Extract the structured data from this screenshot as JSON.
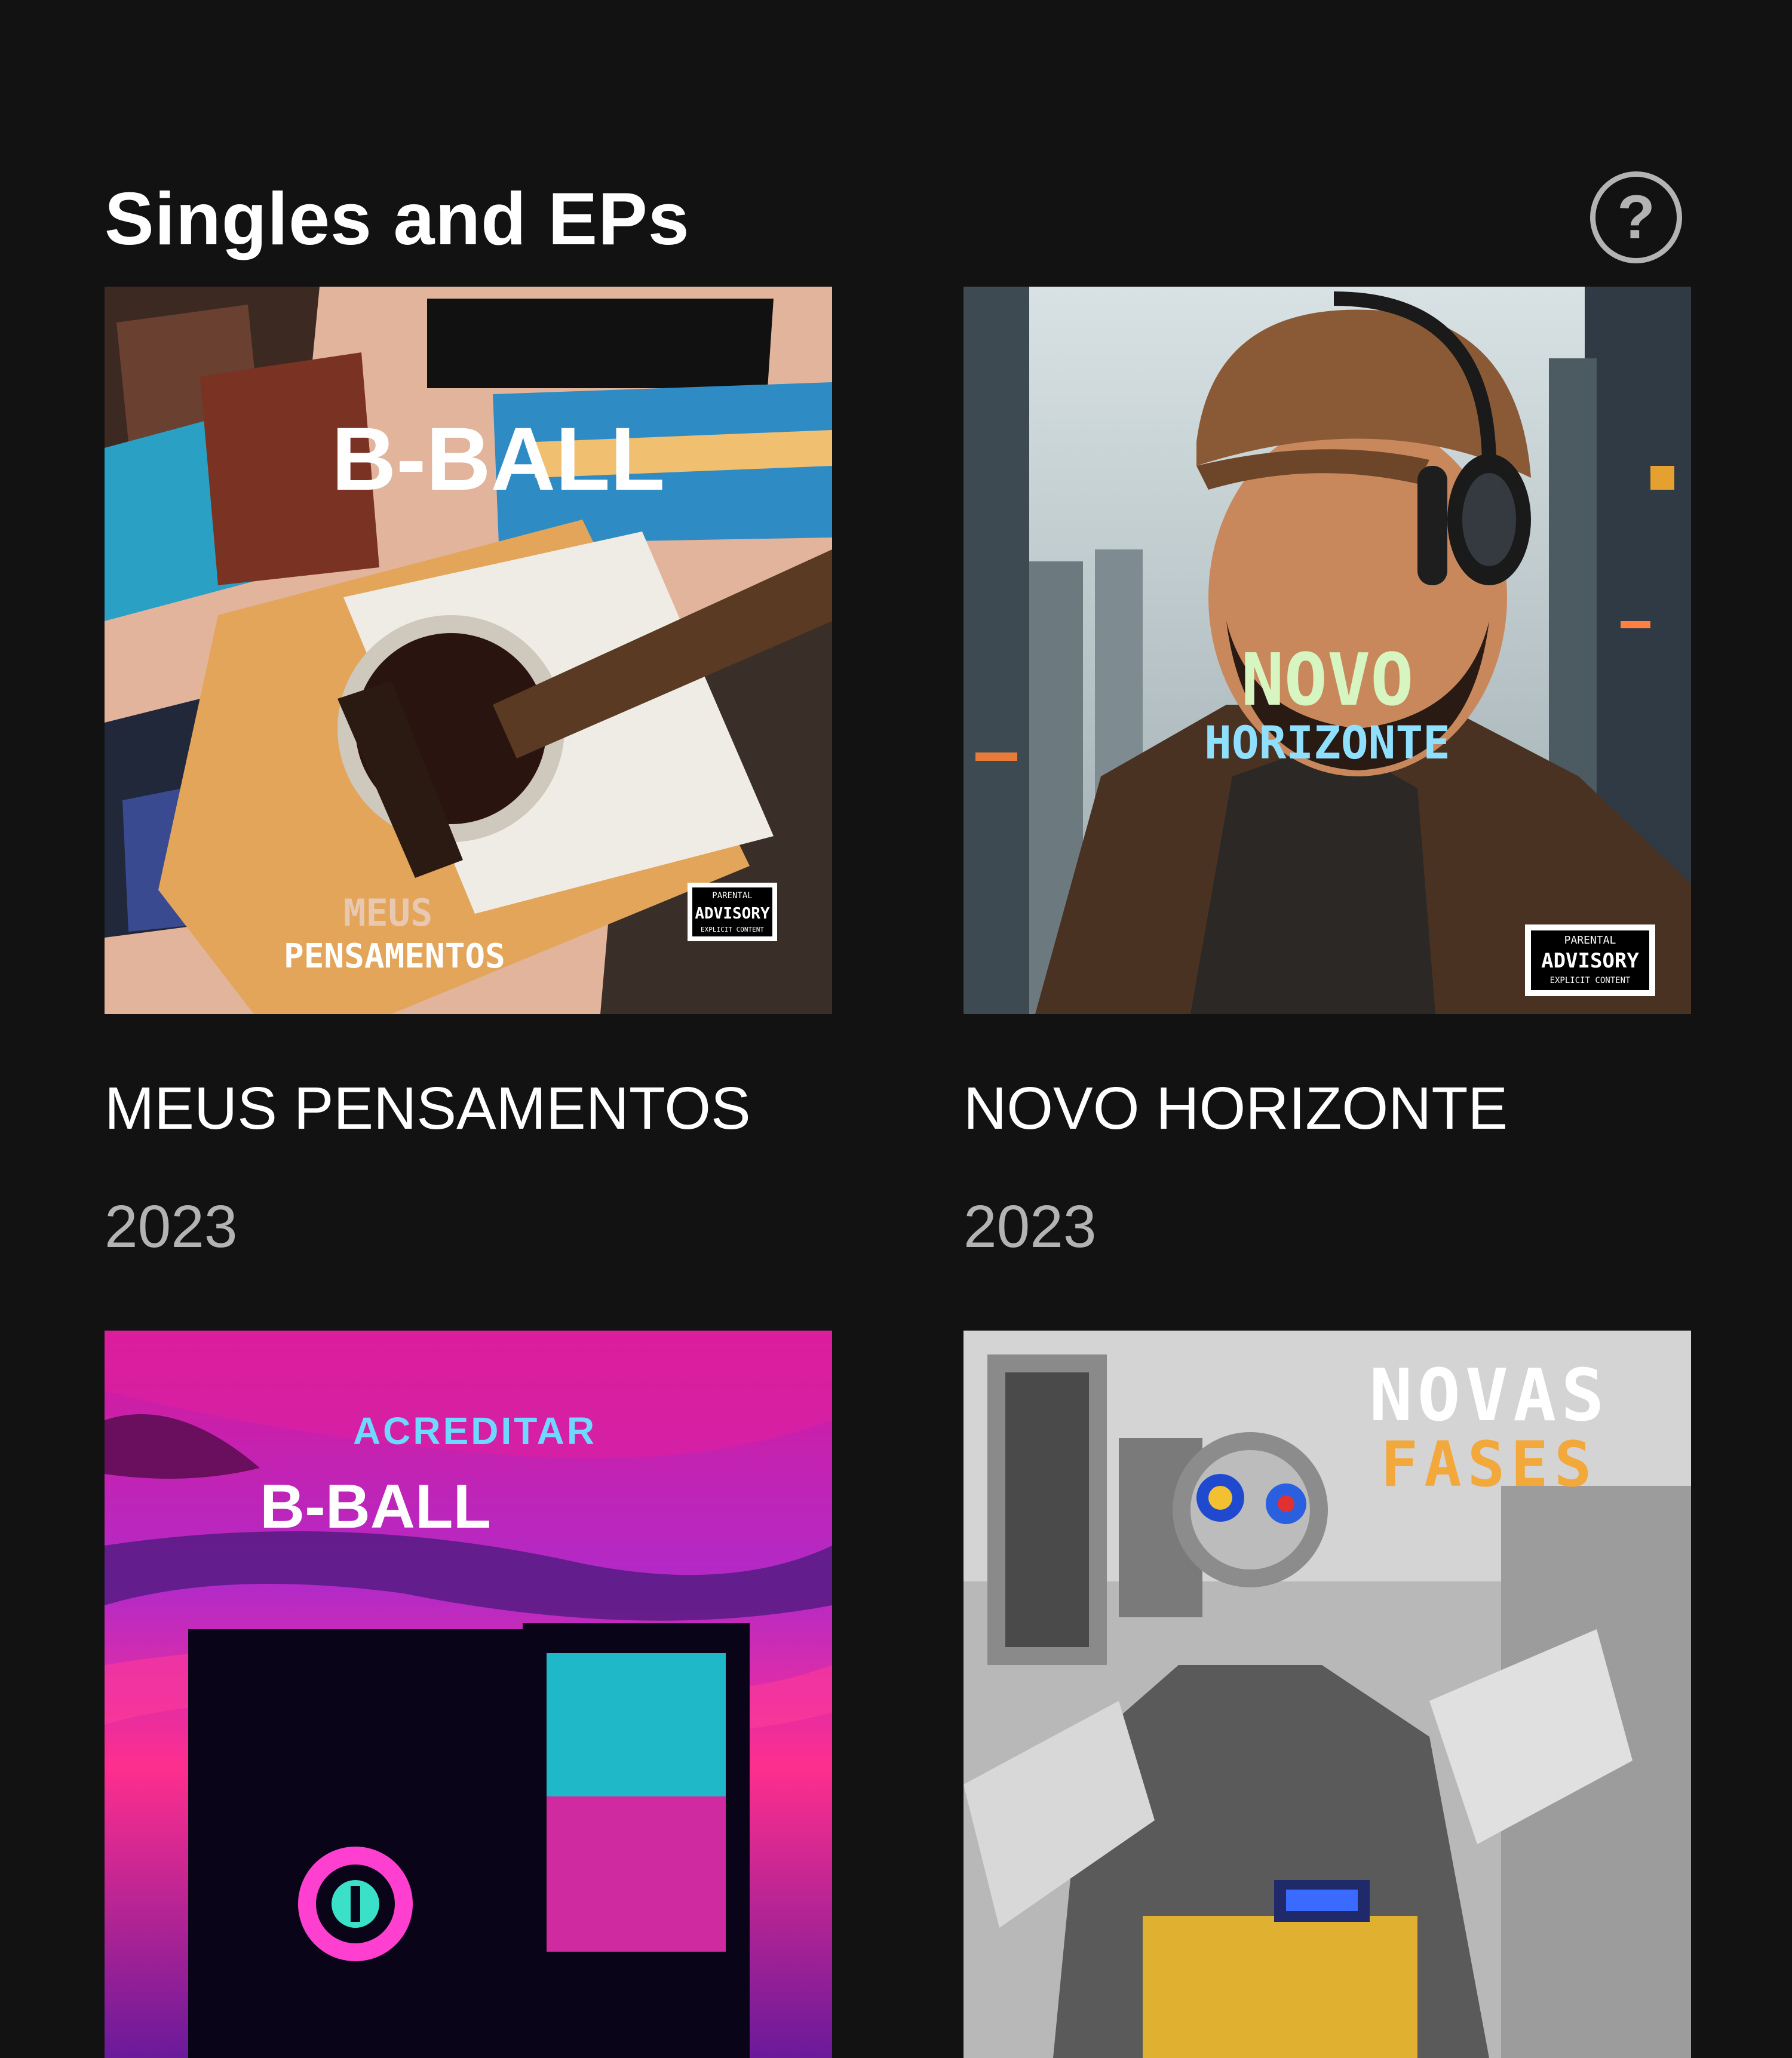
{
  "section": {
    "title": "Singles and EPs",
    "help_icon_glyph": "?"
  },
  "releases": [
    {
      "title": "MEUS PENSAMENTOS",
      "year": "2023",
      "cover": {
        "artist_logo": "B-BALL",
        "line1": "MEUS",
        "line2": "PENSAMENTOS",
        "advisory_top": "PARENTAL",
        "advisory_main": "ADVISORY",
        "advisory_bottom": "EXPLICIT CONTENT"
      }
    },
    {
      "title": "NOVO HORIZONTE",
      "year": "2023",
      "cover": {
        "line1": "NOVO",
        "line2": "HORIZONTE",
        "advisory_top": "PARENTAL",
        "advisory_main": "ADVISORY",
        "advisory_bottom": "EXPLICIT CONTENT"
      }
    },
    {
      "cover": {
        "line1": "ACREDITAR",
        "line2": "B-BALL"
      }
    },
    {
      "cover": {
        "line1": "NOVAS",
        "line2": "FASES"
      }
    }
  ],
  "colors": {
    "background": "#121212",
    "text_primary": "#ffffff",
    "text_secondary": "#b3b3b3"
  }
}
